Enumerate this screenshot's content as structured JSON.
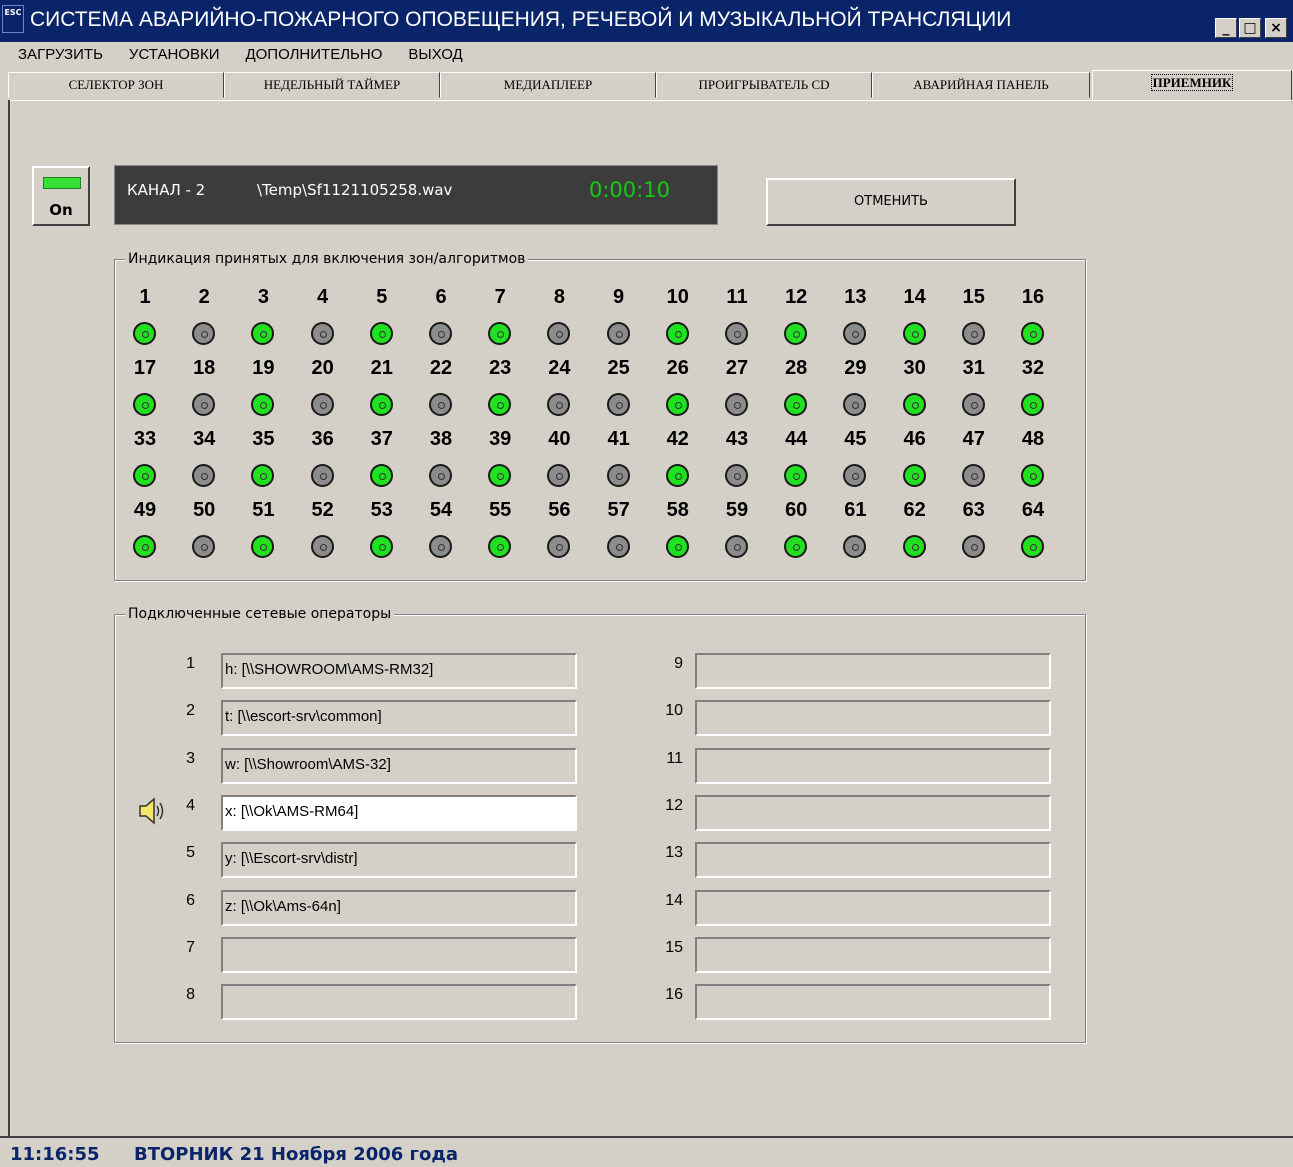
{
  "window": {
    "title": "СИСТЕМА АВАРИЙНО-ПОЖАРНОГО ОПОВЕЩЕНИЯ, РЕЧЕВОЙ И МУЗЫКАЛЬНОЙ ТРАНСЛЯЦИИ",
    "icon_text": "ESC",
    "minimize": "_",
    "maximize": "□",
    "close": "×"
  },
  "menu": [
    "ЗАГРУЗИТЬ",
    "УСТАНОВКИ",
    "ДОПОЛНИТЕЛЬНО",
    "ВЫХОД"
  ],
  "tabs": [
    "СЕЛЕКТОР ЗОН",
    "НЕДЕЛЬНЫЙ ТАЙМЕР",
    "МЕДИАПЛЕЕР",
    "ПРОИГРЫВАТЕЛЬ CD",
    "АВАРИЙНАЯ ПАНЕЛЬ",
    "ПРИЕМНИК"
  ],
  "active_tab": "ПРИЕМНИК",
  "indicator": {
    "label": "On",
    "color": "#33e033"
  },
  "display": {
    "channel": "КАНАЛ - 2",
    "file": "\\Temp\\Sf1121105258.wav",
    "timer": "0:00:10"
  },
  "cancel_label": "ОТМЕНИТЬ",
  "zones": {
    "legend": "Индикация принятых для включения зон/алгоритмов",
    "count": 64,
    "active": [
      1,
      3,
      5,
      7,
      10,
      12,
      14,
      16,
      17,
      19,
      21,
      23,
      26,
      28,
      30,
      32,
      33,
      35,
      37,
      39,
      42,
      44,
      46,
      48,
      49,
      51,
      53,
      55,
      58,
      60,
      62,
      64
    ],
    "on_color": "#20e020",
    "off_color": "#8c8c8c"
  },
  "operators": {
    "legend": "Подключенные сетевые операторы",
    "active_index": 4,
    "left": [
      {
        "num": "1",
        "value": "h: [\\\\SHOWROOM\\AMS-RM32]"
      },
      {
        "num": "2",
        "value": "t: [\\\\escort-srv\\common]"
      },
      {
        "num": "3",
        "value": "w: [\\\\Showroom\\AMS-32]"
      },
      {
        "num": "4",
        "value": "x: [\\\\Ok\\AMS-RM64]"
      },
      {
        "num": "5",
        "value": "y: [\\\\Escort-srv\\distr]"
      },
      {
        "num": "6",
        "value": "z: [\\\\Ok\\Ams-64n]"
      },
      {
        "num": "7",
        "value": ""
      },
      {
        "num": "8",
        "value": ""
      }
    ],
    "right": [
      {
        "num": "9",
        "value": ""
      },
      {
        "num": "10",
        "value": ""
      },
      {
        "num": "11",
        "value": ""
      },
      {
        "num": "12",
        "value": ""
      },
      {
        "num": "13",
        "value": ""
      },
      {
        "num": "14",
        "value": ""
      },
      {
        "num": "15",
        "value": ""
      },
      {
        "num": "16",
        "value": ""
      }
    ]
  },
  "status": {
    "time": "11:16:55",
    "date": "ВТОРНИК 21 Ноября 2006 года"
  }
}
